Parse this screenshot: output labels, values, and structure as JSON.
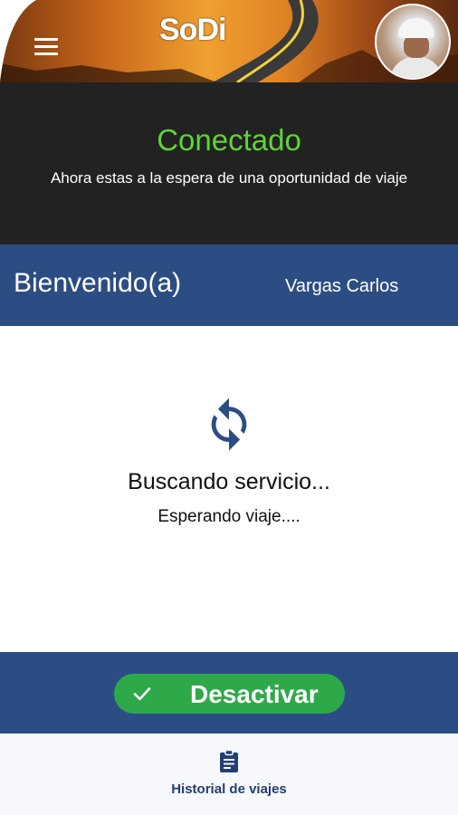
{
  "header": {
    "logo_text": "SoDi",
    "menu_icon": "hamburger-menu-icon",
    "avatar": "driver-profile-photo"
  },
  "status": {
    "title": "Conectado",
    "subtitle": "Ahora estas a la espera de una oportunidad de viaje",
    "title_color": "#5fd33a"
  },
  "welcome": {
    "label": "Bienvenido(a)",
    "name": "Vargas Carlos"
  },
  "search": {
    "icon": "refresh-icon",
    "title": "Buscando servicio...",
    "subtitle": "Esperando viaje...."
  },
  "action": {
    "toggle_label": "Desactivar",
    "toggle_icon": "check-icon",
    "toggle_color": "#2ea94a"
  },
  "bottom_nav": {
    "items": [
      {
        "label": "Historial de viajes",
        "icon": "clipboard-icon"
      }
    ]
  },
  "colors": {
    "primary": "#2c4d84",
    "dark_panel": "#222222",
    "accent_green": "#2ea94a"
  }
}
